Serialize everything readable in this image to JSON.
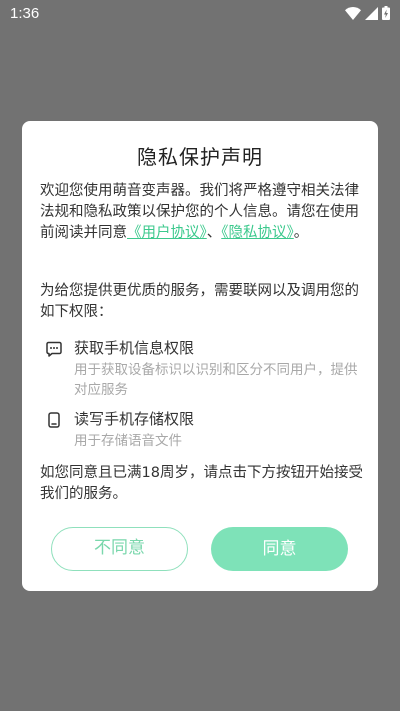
{
  "status_bar": {
    "time": "1:36"
  },
  "dialog": {
    "title": "隐私保护声明",
    "intro_text": "欢迎您使用萌音变声器。我们将严格遵守相关法律法规和隐私政策以保护您的个人信息。请您在使用前阅读并同意",
    "link_open_1": "《",
    "user_agreement_link": "用户协议",
    "link_close_1": "》",
    "link_separator": "、",
    "link_open_2": "《",
    "privacy_link": "隐私协议",
    "link_close_2": "》",
    "intro_end": "。",
    "permission_intro": "为给您提供更优质的服务，需要联网以及调用您的如下权限：",
    "permissions": [
      {
        "title": "获取手机信息权限",
        "description": "用于获取设备标识以识别和区分不同用户，提供对应服务",
        "icon": "chat-bubble-icon"
      },
      {
        "title": "读写手机存储权限",
        "description": "用于存储语音文件",
        "icon": "phone-storage-icon"
      }
    ],
    "outro": "如您同意且已满18周岁，请点击下方按钮开始接受我们的服务。",
    "disagree_label": "不同意",
    "agree_label": "同意"
  },
  "colors": {
    "accent": "#3cc98d",
    "agree_button": "#7ee2b8",
    "overlay": "#727272"
  }
}
